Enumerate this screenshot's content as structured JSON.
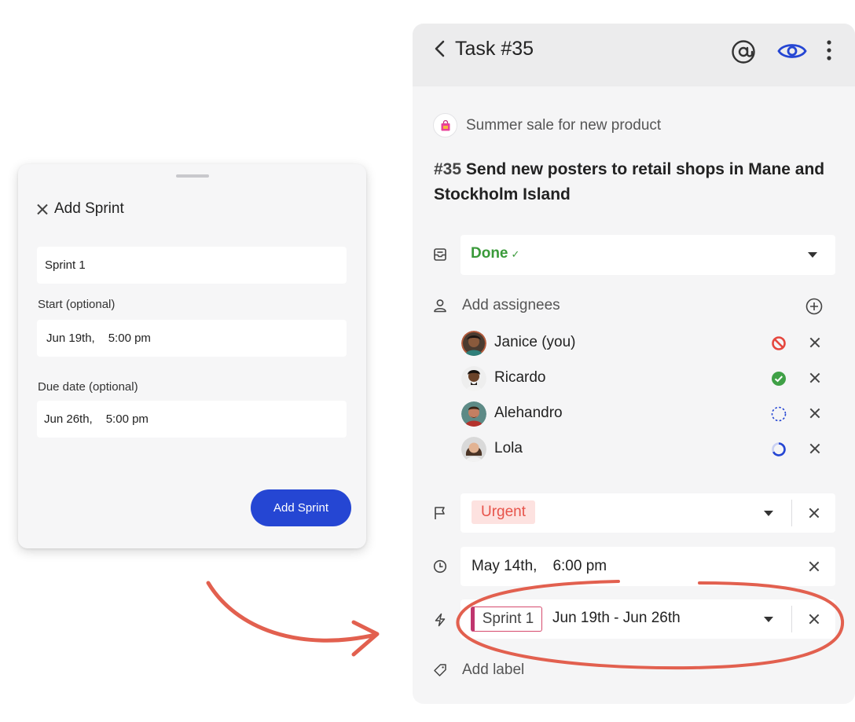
{
  "add_sprint": {
    "title": "Add Sprint",
    "name_value": "Sprint 1",
    "start_label": "Start (optional)",
    "start_date": "Jun 19th,",
    "start_time": "5:00 pm",
    "due_label": "Due date (optional)",
    "due_date": "Jun 26th,",
    "due_time": "5:00 pm",
    "submit_label": "Add Sprint"
  },
  "task": {
    "header_title": "Task #35",
    "project_name": "Summer sale for new product",
    "number": "#35",
    "title": "Send new posters to retail shops in Mane and Stockholm Island",
    "status": "Done",
    "status_check": "✓",
    "add_assignees_label": "Add assignees",
    "assignees": [
      {
        "name": "Janice (you)",
        "status": "blocked",
        "status_color": "#e5463d"
      },
      {
        "name": "Ricardo",
        "status": "done",
        "status_color": "#3fa046"
      },
      {
        "name": "Alehandro",
        "status": "not-started",
        "status_color": "#2546d3"
      },
      {
        "name": "Lola",
        "status": "in-progress",
        "status_color": "#2546d3"
      }
    ],
    "priority": "Urgent",
    "due_date": "May 14th,",
    "due_time": "6:00 pm",
    "sprint_name": "Sprint 1",
    "sprint_range": "Jun 19th - Jun 26th",
    "add_label": "Add label"
  },
  "colors": {
    "accent": "#2546d3",
    "done_green": "#3a9a3a",
    "urgent_red": "#e7534a",
    "annotation": "#e2604f"
  }
}
